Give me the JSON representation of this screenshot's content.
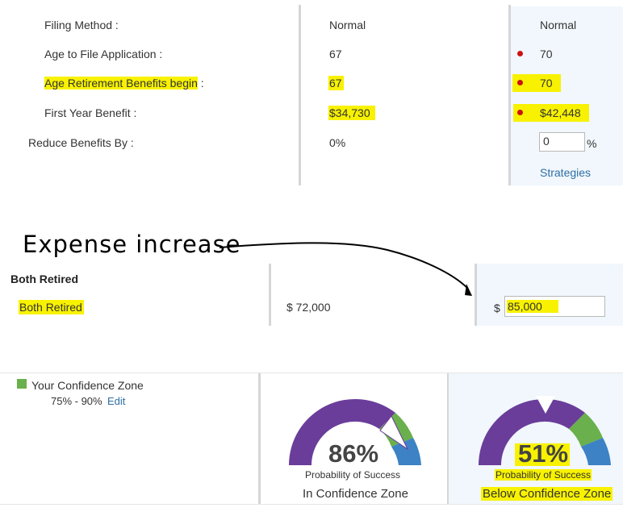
{
  "benefits": {
    "rows": [
      {
        "label": "Filing Method :",
        "current": "Normal",
        "proposed": "Normal"
      },
      {
        "label": "Age to File Application :",
        "current": "67",
        "proposed": "70"
      },
      {
        "label": "Age Retirement Benefits begin",
        "label_suffix": " :",
        "current": "67",
        "proposed": "70"
      },
      {
        "label": "First Year Benefit :",
        "current": "$34,730",
        "proposed": "$42,448"
      }
    ],
    "reduce": {
      "label": "Reduce Benefits By :",
      "current": "0%",
      "input_value": "0",
      "unit": "%"
    },
    "strategies_link": "Strategies"
  },
  "annotation": {
    "handwritten": "Expense increase"
  },
  "expenses": {
    "header": "Both Retired",
    "row_label": "Both Retired",
    "current": "$ 72,000",
    "currency_symbol": "$",
    "input_value": "85,000"
  },
  "confidence": {
    "legend_label": "Your Confidence Zone",
    "range": "75% - 90%",
    "edit_link": "Edit",
    "zone_color": "#6ab04c",
    "gauges": [
      {
        "value": "86%",
        "percent": 86,
        "subtitle": "Probability of Success",
        "caption": "In Confidence Zone"
      },
      {
        "value": "51%",
        "percent": 51,
        "subtitle": "Probability of Success",
        "caption": "Below Confidence Zone"
      }
    ]
  },
  "colors": {
    "purple": "#6a3d9a",
    "green": "#6ab04c",
    "blue": "#3c82c4",
    "highlight": "#f8f200",
    "link": "#2f6ea5"
  }
}
